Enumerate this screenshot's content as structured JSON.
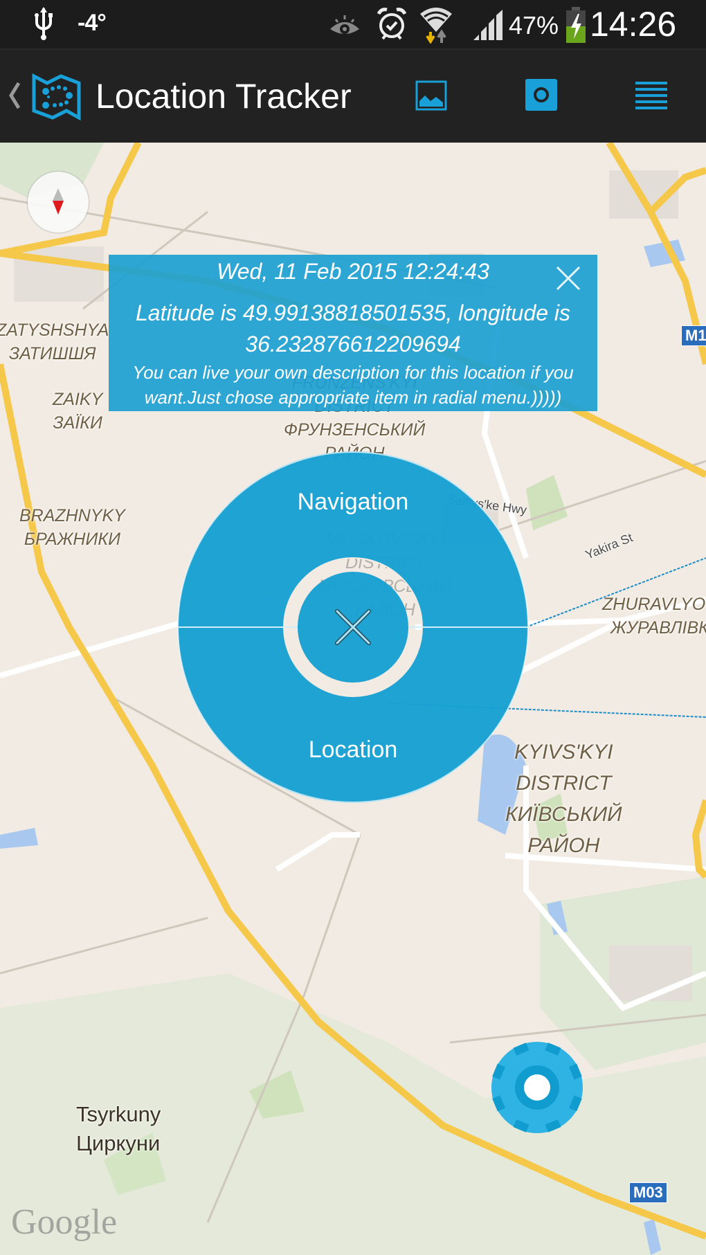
{
  "status_bar": {
    "temperature": "-4°",
    "battery_percent": "47%",
    "time": "14:26",
    "icons": [
      "usb-icon",
      "eye-icon",
      "alarm-icon",
      "wifi-icon",
      "signal-icon",
      "battery-charging-icon"
    ],
    "battery_level": 0.47
  },
  "action_bar": {
    "title": "Location Tracker",
    "actions": [
      "gallery-icon",
      "camera-icon",
      "list-menu-icon"
    ]
  },
  "info_panel": {
    "date": "Wed, 11 Feb 2015 12:24:43",
    "coords": "Latitude is 49.99138818501535, longitude is 36.232876612209694",
    "description": "You can live your own description for this location if you want.Just chose appropriate item in radial menu.)))))"
  },
  "radial_menu": {
    "top_label": "Navigation",
    "bottom_label": "Location"
  },
  "map": {
    "labels": {
      "zatyshshya": "ZATYSHSHYA\nЗАТИШШЯ",
      "zaiky": "ZAIKY\nЗАЇКИ",
      "brazhnyky": "BRAZHNYKY\nБРАЖНИКИ",
      "frunzenskyi": "FRUNZENS'KYI\nDISTRICT\nФРУНЗЕНСЬКИЙ\nРАЙОН",
      "moskovskyi": "MOSKOVS'KYI\nDISTRICT\nМОСКОВСЬКИЙ\nРАЙОН",
      "zhuravlivka": "ZHURAVLYOV\nЖУРАВЛІВК",
      "kyivskyi": "KYIVS'KYI\nDISTRICT\nКИЇВСЬКИЙ\nРАЙОН",
      "tsyrkuny": "Tsyrkuny\nЦиркуни",
      "saltivske": "Saltivs'ke Hwy",
      "yakira": "Yakira St"
    },
    "shields": [
      "M03",
      "M1"
    ],
    "attribution": "Google"
  }
}
